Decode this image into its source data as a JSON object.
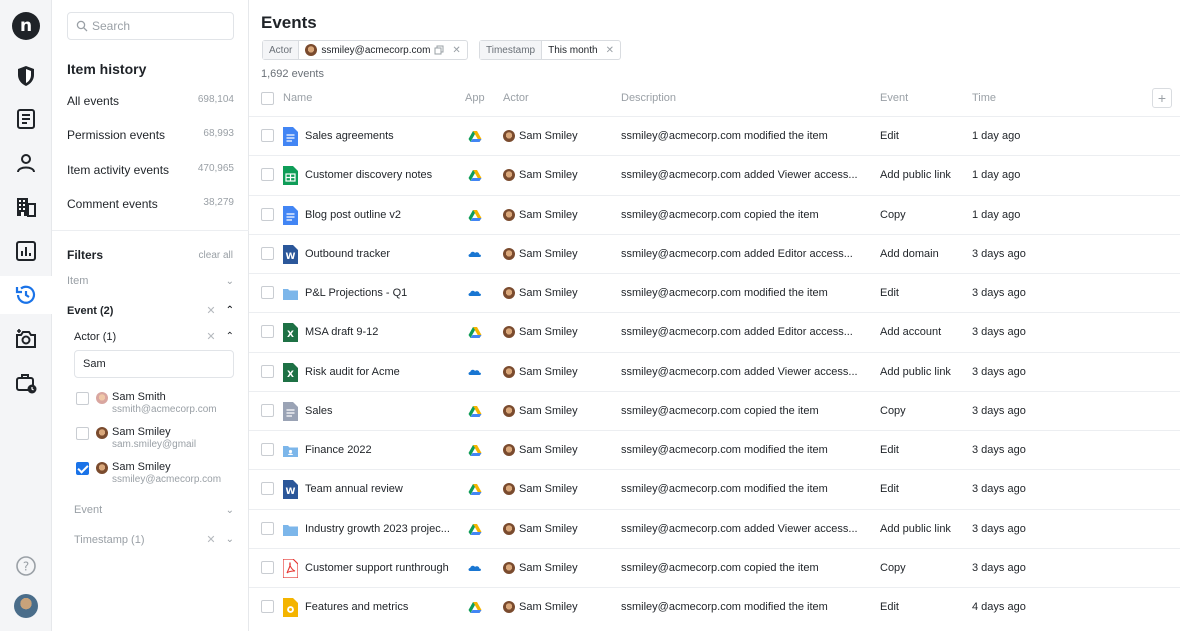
{
  "rail": {
    "logo": "n",
    "items": [
      {
        "icon": "shield-icon"
      },
      {
        "icon": "document-list-icon"
      },
      {
        "icon": "user-icon"
      },
      {
        "icon": "building-icon"
      },
      {
        "icon": "bar-chart-icon"
      },
      {
        "icon": "history-icon",
        "active": true
      },
      {
        "icon": "camera-add-icon"
      },
      {
        "icon": "briefcase-clock-icon"
      }
    ],
    "help_icon": "help-icon"
  },
  "sidebar": {
    "search_placeholder": "Search",
    "title": "Item history",
    "history": [
      {
        "label": "All events",
        "count": "698,104"
      },
      {
        "label": "Permission events",
        "count": "68,993"
      },
      {
        "label": "Item activity events",
        "count": "470,965"
      },
      {
        "label": "Comment events",
        "count": "38,279"
      }
    ],
    "filters_title": "Filters",
    "clear_all": "clear all",
    "item_filter": "Item",
    "event_filter": "Event (2)",
    "actor_filter": "Actor (1)",
    "actor_query": "Sam",
    "people": [
      {
        "name": "Sam Smith",
        "email": "ssmith@acmecorp.com",
        "checked": false
      },
      {
        "name": "Sam Smiley",
        "email": "sam.smiley@gmail",
        "checked": false
      },
      {
        "name": "Sam Smiley",
        "email": "ssmiley@acmecorp.com",
        "checked": true
      }
    ],
    "event_sub_filter": "Event",
    "timestamp_filter": "Timestamp (1)"
  },
  "main": {
    "title": "Events",
    "chips": {
      "actor_key": "Actor",
      "actor_value": "ssmiley@acmecorp.com",
      "timestamp_key": "Timestamp",
      "timestamp_value": "This month"
    },
    "total": "1,692 events",
    "columns": {
      "name": "Name",
      "app": "App",
      "actor": "Actor",
      "description": "Description",
      "event": "Event",
      "time": "Time"
    },
    "rows": [
      {
        "name": "Sales agreements",
        "type": "doc",
        "app": "gdrive",
        "actor": "Sam Smiley",
        "description": "ssmiley@acmecorp.com modified the item",
        "event": "Edit",
        "time": "1 day ago"
      },
      {
        "name": "Customer discovery notes",
        "type": "sheet",
        "app": "gdrive",
        "actor": "Sam Smiley",
        "description": "ssmiley@acmecorp.com added Viewer access...",
        "event": "Add public link",
        "time": "1 day ago"
      },
      {
        "name": "Blog post outline v2",
        "type": "doc",
        "app": "gdrive",
        "actor": "Sam Smiley",
        "description": "ssmiley@acmecorp.com copied the item",
        "event": "Copy",
        "time": "1 day ago"
      },
      {
        "name": "Outbound tracker",
        "type": "word",
        "app": "onedrive",
        "actor": "Sam Smiley",
        "description": "ssmiley@acmecorp.com added Editor access...",
        "event": "Add domain",
        "time": "3 days ago"
      },
      {
        "name": "P&L Projections - Q1",
        "type": "folder",
        "app": "onedrive",
        "actor": "Sam Smiley",
        "description": "ssmiley@acmecorp.com modified the item",
        "event": "Edit",
        "time": "3 days ago"
      },
      {
        "name": "MSA draft 9-12",
        "type": "excel",
        "app": "gdrive",
        "actor": "Sam Smiley",
        "description": "ssmiley@acmecorp.com added Editor access...",
        "event": "Add account",
        "time": "3 days ago"
      },
      {
        "name": "Risk audit for Acme",
        "type": "excel",
        "app": "onedrive",
        "actor": "Sam Smiley",
        "description": "ssmiley@acmecorp.com added Viewer access...",
        "event": "Add public link",
        "time": "3 days ago"
      },
      {
        "name": "Sales",
        "type": "gray",
        "app": "gdrive",
        "actor": "Sam Smiley",
        "description": "ssmiley@acmecorp.com copied the item",
        "event": "Copy",
        "time": "3 days ago"
      },
      {
        "name": "Finance 2022",
        "type": "sharedfolder",
        "app": "gdrive",
        "actor": "Sam Smiley",
        "description": "ssmiley@acmecorp.com modified the item",
        "event": "Edit",
        "time": "3 days ago"
      },
      {
        "name": "Team annual review",
        "type": "word",
        "app": "gdrive",
        "actor": "Sam Smiley",
        "description": "ssmiley@acmecorp.com modified the item",
        "event": "Edit",
        "time": "3 days ago"
      },
      {
        "name": "Industry growth 2023 projec...",
        "type": "folder",
        "app": "gdrive",
        "actor": "Sam Smiley",
        "description": "ssmiley@acmecorp.com added Viewer access...",
        "event": "Add public link",
        "time": "3 days ago"
      },
      {
        "name": "Customer support runthrough",
        "type": "pdf",
        "app": "onedrive",
        "actor": "Sam Smiley",
        "description": "ssmiley@acmecorp.com copied the item",
        "event": "Copy",
        "time": "3 days ago"
      },
      {
        "name": "Features and metrics",
        "type": "slides",
        "app": "gdrive",
        "actor": "Sam Smiley",
        "description": "ssmiley@acmecorp.com modified the item",
        "event": "Edit",
        "time": "4 days ago"
      }
    ]
  },
  "colors": {
    "doc": "#4285f4",
    "sheet": "#0f9d58",
    "word": "#2b579a",
    "excel": "#1e7145",
    "folder": "#7cb6ea",
    "gray": "#9aa3b5",
    "pdf": "#e53935",
    "slides": "#f4b400",
    "checkbox_checked": "#1a73e8",
    "onedrive": "#1976d2"
  }
}
